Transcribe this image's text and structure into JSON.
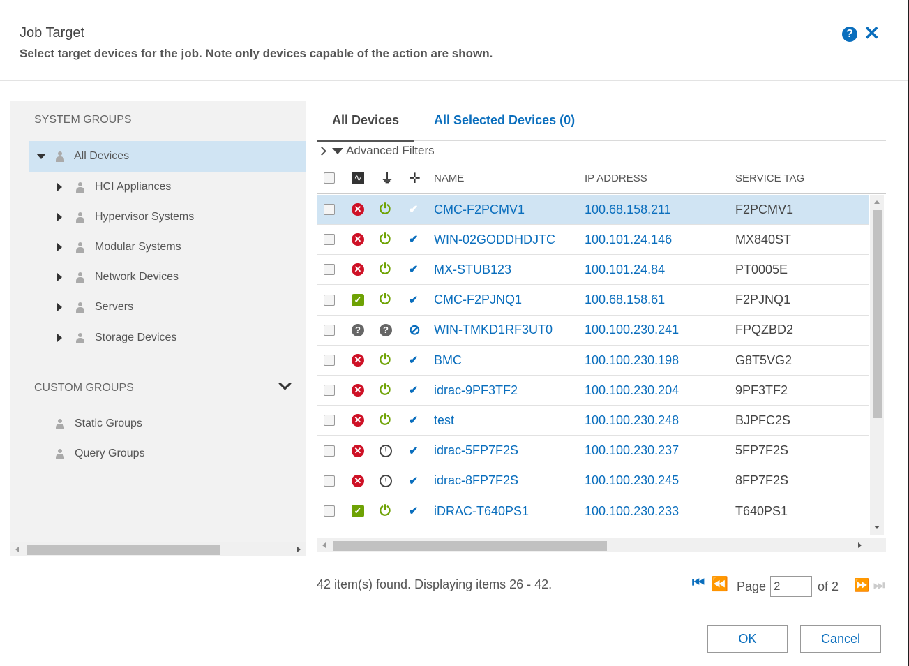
{
  "dialog": {
    "title": "Job Target",
    "subtitle": "Select target devices for the job. Note only devices capable of the action are shown.",
    "help_icon": "question-circle-icon",
    "close_icon": "close-x-icon"
  },
  "left": {
    "system_groups_label": "SYSTEM GROUPS",
    "root": "All Devices",
    "children": [
      "HCI Appliances",
      "Hypervisor Systems",
      "Modular Systems",
      "Network Devices",
      "Servers",
      "Storage Devices"
    ],
    "custom_groups_label": "CUSTOM GROUPS",
    "custom": [
      "Static Groups",
      "Query Groups"
    ]
  },
  "tabs": {
    "all": "All Devices",
    "selected": "All Selected Devices (0)"
  },
  "filters_label": "Advanced Filters",
  "columns": {
    "name": "NAME",
    "ip": "IP ADDRESS",
    "service_tag": "SERVICE TAG"
  },
  "rows": [
    {
      "name": "CMC-F2PCMV1",
      "ip": "100.68.158.211",
      "tag": "F2PCMV1",
      "health": "critical",
      "power": "on",
      "conn": "faint"
    },
    {
      "name": "WIN-02GODDHDJTC",
      "ip": "100.101.24.146",
      "tag": "MX840ST",
      "health": "critical",
      "power": "on",
      "conn": "ok"
    },
    {
      "name": "MX-STUB123",
      "ip": "100.101.24.84",
      "tag": "PT0005E",
      "health": "critical",
      "power": "on",
      "conn": "ok"
    },
    {
      "name": "CMC-F2PJNQ1",
      "ip": "100.68.158.61",
      "tag": "F2PJNQ1",
      "health": "ok",
      "power": "on",
      "conn": "ok"
    },
    {
      "name": "WIN-TMKD1RF3UT0",
      "ip": "100.100.230.241",
      "tag": "FPQZBD2",
      "health": "unknown",
      "power": "unknown",
      "conn": "none"
    },
    {
      "name": "BMC",
      "ip": "100.100.230.198",
      "tag": "G8T5VG2",
      "health": "critical",
      "power": "on",
      "conn": "ok"
    },
    {
      "name": "idrac-9PF3TF2",
      "ip": "100.100.230.204",
      "tag": "9PF3TF2",
      "health": "critical",
      "power": "on",
      "conn": "ok"
    },
    {
      "name": "test",
      "ip": "100.100.230.248",
      "tag": "BJPFC2S",
      "health": "critical",
      "power": "on",
      "conn": "ok"
    },
    {
      "name": "idrac-5FP7F2S",
      "ip": "100.100.230.237",
      "tag": "5FP7F2S",
      "health": "critical",
      "power": "off",
      "conn": "ok"
    },
    {
      "name": "idrac-8FP7F2S",
      "ip": "100.100.230.245",
      "tag": "8FP7F2S",
      "health": "critical",
      "power": "off",
      "conn": "ok"
    },
    {
      "name": "iDRAC-T640PS1",
      "ip": "100.100.230.233",
      "tag": "T640PS1",
      "health": "ok",
      "power": "on",
      "conn": "ok"
    }
  ],
  "footer": {
    "found_text": "42 item(s) found. Displaying items 26 - 42.",
    "page_label": "Page",
    "page_value": "2",
    "of_label": "of 2"
  },
  "buttons": {
    "ok": "OK",
    "cancel": "Cancel"
  },
  "colors": {
    "accent": "#0a6ebd",
    "critical": "#ce1126",
    "ok": "#6ea204",
    "selected_row": "#d0e4f3"
  }
}
